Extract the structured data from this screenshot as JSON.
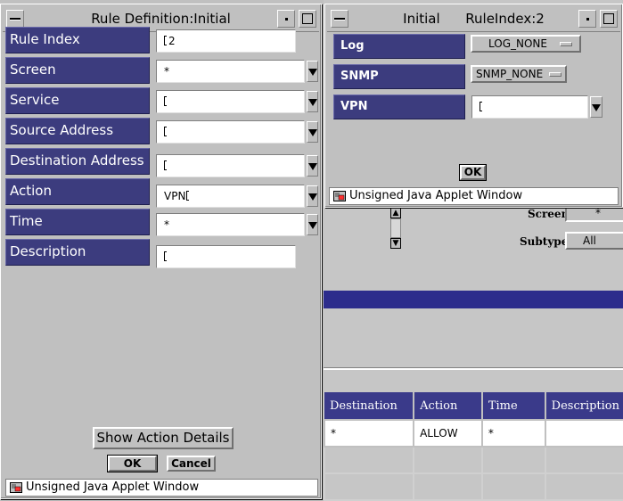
{
  "background": {
    "screen_label": "Screen",
    "screen_value": "*",
    "subtype_label": "Subtype",
    "subtype_value": "All",
    "table": {
      "headers": [
        "Destination",
        "Action",
        "Time",
        "Description"
      ],
      "rows": [
        [
          "*",
          "ALLOW",
          "*",
          ""
        ]
      ]
    }
  },
  "rule_window": {
    "title": "Rule Definition:Initial",
    "fields": [
      {
        "label": "Rule Index",
        "value": "2",
        "type": "text"
      },
      {
        "label": "Screen",
        "value": "*",
        "type": "dropdown"
      },
      {
        "label": "Service",
        "value": "",
        "type": "dropdown"
      },
      {
        "label": "Source Address",
        "value": "",
        "type": "dropdown"
      },
      {
        "label": "Destination Address",
        "value": "",
        "type": "dropdown"
      },
      {
        "label": "Action",
        "value": "VPN",
        "type": "dropdown"
      },
      {
        "label": "Time",
        "value": "*",
        "type": "dropdown"
      },
      {
        "label": "Description",
        "value": "",
        "type": "text"
      }
    ],
    "show_action_details": "Show Action Details",
    "ok": "OK",
    "cancel": "Cancel",
    "status": "Unsigned Java Applet Window"
  },
  "action_window": {
    "title": "Initial      RuleIndex:2",
    "rows": [
      {
        "label": "Log",
        "value": "LOG_NONE"
      },
      {
        "label": "SNMP",
        "value": "SNMP_NONE"
      },
      {
        "label": "VPN",
        "value": ""
      }
    ],
    "ok": "OK",
    "status": "Unsigned Java Applet Window"
  },
  "colors": {
    "label_bg": "#3c3c7e",
    "table_header_bg": "#3a3a8a",
    "window_bg": "#c0c0c0"
  }
}
